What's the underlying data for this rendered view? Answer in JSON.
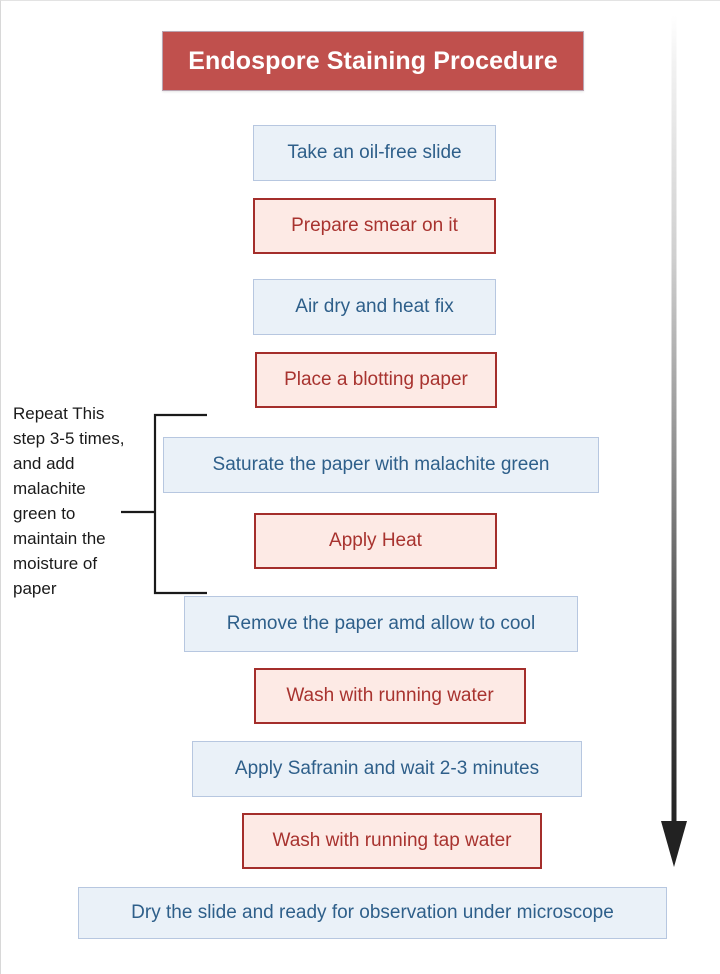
{
  "header": {
    "title": "Endospore Staining Procedure",
    "background_color": "#c0504d",
    "text_color": "#ffffff"
  },
  "theme": {
    "blue_fill": "#eaf1f8",
    "blue_border": "#b7c7e0",
    "blue_text": "#2e5f8a",
    "red_fill": "#fdeae5",
    "red_border": "#a42e2b",
    "red_text": "#a8332f",
    "arrow_color": "#222222",
    "page_background": "#ffffff"
  },
  "annotation": {
    "text": "Repeat This step 3-5 times, and add malachite green to maintain the moisture of paper",
    "bracket_icon": "left-bracket-connector",
    "covers_steps": [
      "Saturate the paper with malachite green",
      "Apply Heat"
    ]
  },
  "flow_arrow": {
    "icon": "down-arrow-icon",
    "direction": "down",
    "description": "Vertical gradient arrow indicating overall procedure direction"
  },
  "chart_data": {
    "type": "flowchart",
    "title": "Endospore Staining Procedure",
    "orientation": "vertical",
    "steps": [
      {
        "index": 1,
        "label": "Take an oil-free slide",
        "style": "blue"
      },
      {
        "index": 2,
        "label": "Prepare smear on it",
        "style": "red"
      },
      {
        "index": 3,
        "label": "Air dry and heat fix",
        "style": "blue"
      },
      {
        "index": 4,
        "label": "Place a blotting paper",
        "style": "red"
      },
      {
        "index": 5,
        "label": "Saturate the paper with malachite green",
        "style": "blue"
      },
      {
        "index": 6,
        "label": "Apply Heat",
        "style": "red"
      },
      {
        "index": 7,
        "label": "Remove the paper amd allow to cool",
        "style": "blue"
      },
      {
        "index": 8,
        "label": "Wash with running water",
        "style": "red"
      },
      {
        "index": 9,
        "label": "Apply Safranin and wait 2-3 minutes",
        "style": "blue"
      },
      {
        "index": 10,
        "label": "Wash with running tap water",
        "style": "red"
      },
      {
        "index": 11,
        "label": "Dry the slide and ready for observation under microscope",
        "style": "blue"
      }
    ]
  }
}
